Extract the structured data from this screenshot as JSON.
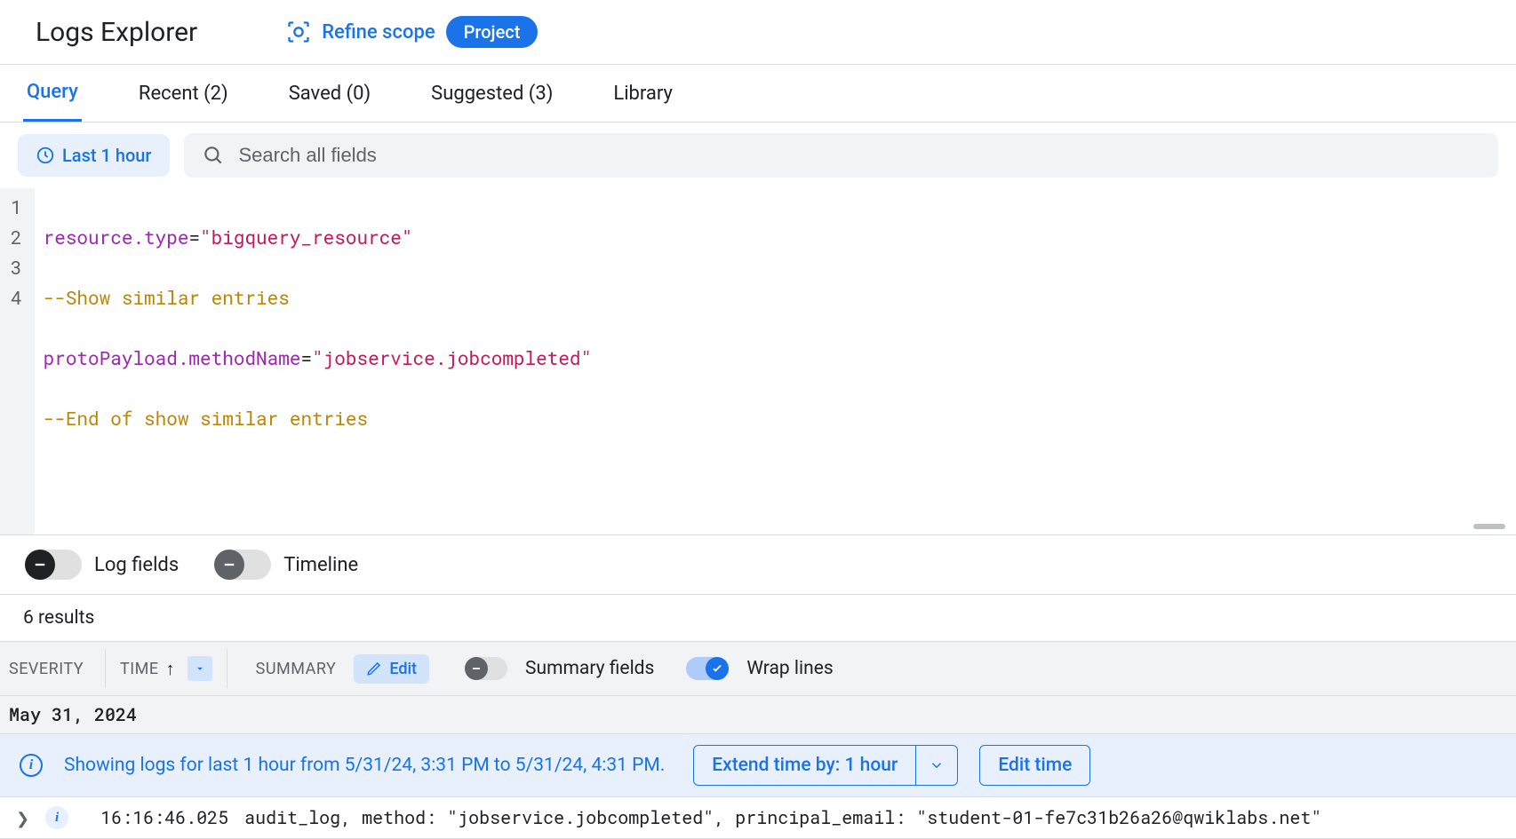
{
  "header": {
    "title": "Logs Explorer",
    "refine_scope_label": "Refine scope",
    "scope_badge": "Project"
  },
  "tabs": {
    "query": "Query",
    "recent": "Recent (2)",
    "saved": "Saved (0)",
    "suggested": "Suggested (3)",
    "library": "Library"
  },
  "query_bar": {
    "time_chip": "Last 1 hour",
    "search_placeholder": "Search all fields"
  },
  "editor": {
    "lines": {
      "1": {
        "key": "resource.type",
        "op": "=",
        "str": "\"bigquery_resource\""
      },
      "2": {
        "comment": "--Show similar entries"
      },
      "3": {
        "key": "protoPayload.methodName",
        "op": "=",
        "str": "\"jobservice.jobcompleted\""
      },
      "4": {
        "comment": "--End of show similar entries"
      }
    },
    "gutter": [
      "1",
      "2",
      "3",
      "4"
    ]
  },
  "toggles": {
    "log_fields": "Log fields",
    "timeline": "Timeline"
  },
  "results": {
    "count_label": "6 results"
  },
  "cols": {
    "severity": "Severity",
    "time": "Time",
    "summary": "Summary",
    "edit_label": "Edit",
    "summary_fields": "Summary fields",
    "wrap_lines": "Wrap lines"
  },
  "date_header": "May 31, 2024",
  "info": {
    "text": "Showing logs for last 1 hour from 5/31/24, 3:31 PM to 5/31/24, 4:31 PM.",
    "extend_label": "Extend time by: 1 hour",
    "edit_time_label": "Edit time"
  },
  "log": {
    "time": "16:16:46.025",
    "summary": "audit_log, method: \"jobservice.jobcompleted\", principal_email: \"student-01-fe7c31b26a26@qwiklabs.net\""
  }
}
